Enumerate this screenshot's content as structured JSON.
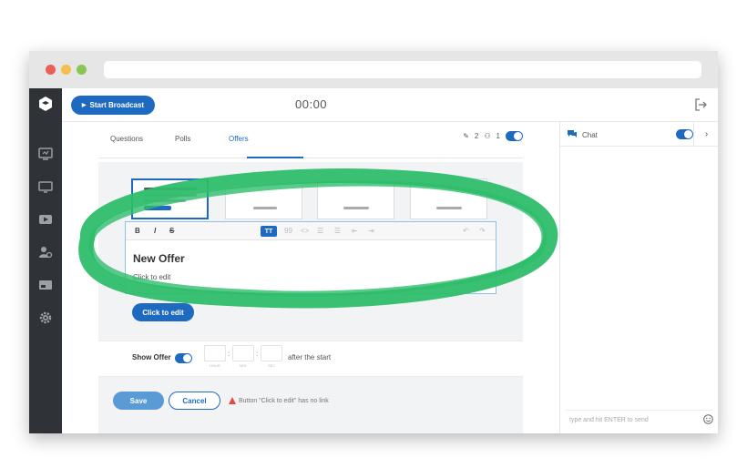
{
  "header": {
    "start_label": "Start Broadcast",
    "timer": "00:00"
  },
  "tabs": [
    {
      "label": "Questions"
    },
    {
      "label": "Polls"
    },
    {
      "label": "Offers"
    }
  ],
  "counters": {
    "questions": "2",
    "people": "1"
  },
  "editor": {
    "toolbar": {
      "bold": "B",
      "italic": "I",
      "strike": "S",
      "active": "TT",
      "quote": "99",
      "code": "<>"
    },
    "title": "New Offer",
    "subtitle": "Click to edit"
  },
  "cta_label": "Click to edit",
  "show_offer": {
    "label": "Show Offer",
    "units": [
      "HOUR",
      "MIN",
      "SEC"
    ],
    "after_text": "after the start"
  },
  "actions": {
    "save": "Save",
    "cancel": "Cancel",
    "warning": "Button \"Click to edit\" has no link"
  },
  "chat": {
    "title": "Chat",
    "placeholder": "type and hit ENTER to send"
  },
  "colors": {
    "accent": "#1f6ac1",
    "highlight": "#2ebd6b",
    "sidebar": "#2f3237"
  }
}
